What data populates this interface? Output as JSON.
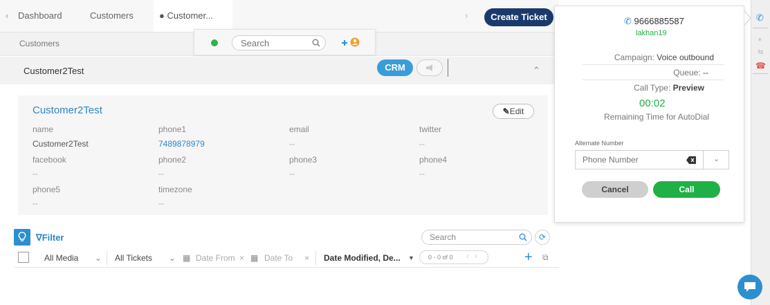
{
  "tabs": [
    {
      "label": "Dashboard"
    },
    {
      "label": "Customers"
    },
    {
      "label": "Customer..."
    }
  ],
  "toolbar": {
    "create_ticket_label": "Create Ticket"
  },
  "breadcrumb": "Customers",
  "searchbar": {
    "placeholder": "Search",
    "status_color": "#2db34a",
    "add_icon": "add-user-icon"
  },
  "customer_header": {
    "name": "Customer2Test",
    "crm_label": "CRM"
  },
  "customer_card": {
    "title": "Customer2Test",
    "edit_label": "Edit",
    "fields": [
      {
        "label": "name",
        "value": "Customer2Test"
      },
      {
        "label": "phone1",
        "value": "7489878979"
      },
      {
        "label": "email",
        "value": "--"
      },
      {
        "label": "twitter",
        "value": "--"
      },
      {
        "label": "facebook",
        "value": "--"
      },
      {
        "label": "phone2",
        "value": "--"
      },
      {
        "label": "phone3",
        "value": "--"
      },
      {
        "label": "phone4",
        "value": "--"
      },
      {
        "label": "phone5",
        "value": "--"
      },
      {
        "label": "timezone",
        "value": "--"
      }
    ]
  },
  "ticket_list": {
    "filter_label": "Filter",
    "search_placeholder": "Search",
    "media_select": "All Media",
    "tickets_select": "All Tickets",
    "date_from": "Date From",
    "date_to": "Date To",
    "sort_label": "Date Modified, De...",
    "pagination": "0 - 0 of 0"
  },
  "phone_panel": {
    "phone_number": "9666885587",
    "agent": "lakhan19",
    "campaign_label": "Campaign:",
    "campaign_value": "Voice outbound",
    "queue_label": "Queue:",
    "queue_value": "--",
    "call_type_label": "Call Type:",
    "call_type_value": "Preview",
    "timer": "00:02",
    "timer_caption": "Remaining Time for AutoDial",
    "alternate_label": "Alternate Number",
    "alternate_placeholder": "Phone Number",
    "cancel_label": "Cancel",
    "call_label": "Call"
  },
  "colors": {
    "accent_blue": "#2d8fd0",
    "navy": "#1b3a6b",
    "green": "#1fb145",
    "link_blue": "#2f86c4"
  }
}
